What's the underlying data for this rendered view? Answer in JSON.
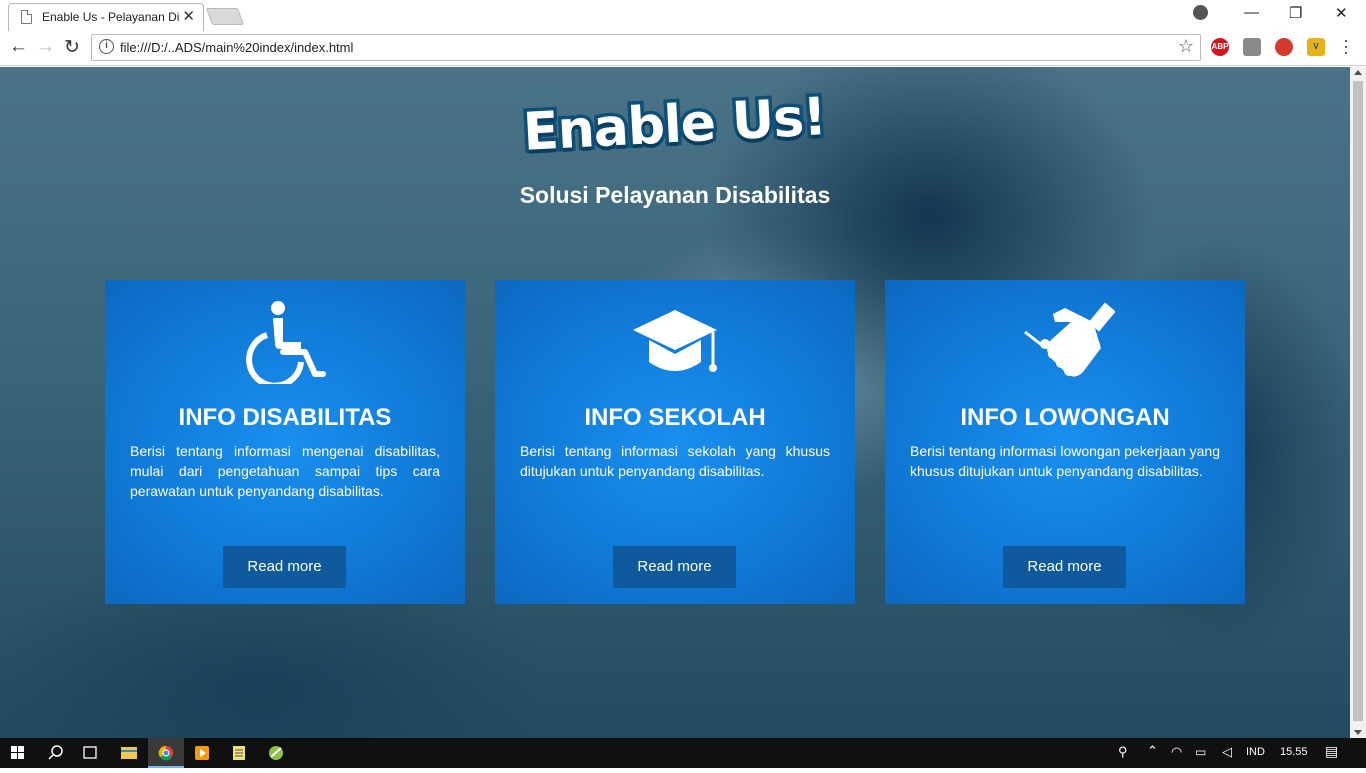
{
  "browser": {
    "tab_title": "Enable Us - Pelayanan Dis",
    "address": "file:///D:/..ADS/main%20index/index.html",
    "window_controls": [
      "—",
      "❐",
      "✕"
    ],
    "extensions": [
      {
        "name": "adblock-plus-icon",
        "label": "ABP",
        "color": "#d5141e"
      },
      {
        "name": "camera-icon",
        "label": "",
        "color": "#8a8a8a"
      },
      {
        "name": "people-icon",
        "label": "",
        "color": "#d33b2c"
      },
      {
        "name": "v-extension-icon",
        "label": "V",
        "color": "#e8b31a"
      }
    ]
  },
  "page": {
    "logo_text": "Enable Us!",
    "subtitle": "Solusi Pelayanan Disabilitas",
    "cards": [
      {
        "icon": "wheelchair-icon",
        "title": "INFO DISABILITAS",
        "description": "Berisi tentang informasi mengenai disabilitas, mulai dari pengetahuan sampai tips cara perawatan untuk penyandang disabilitas.",
        "button": "Read more"
      },
      {
        "icon": "graduation-cap-icon",
        "title": "INFO SEKOLAH",
        "description": "Berisi tentang informasi sekolah yang khusus ditujukan untuk penyandang disabilitas.",
        "button": "Read more"
      },
      {
        "icon": "handshake-icon",
        "title": "INFO LOWONGAN",
        "description": "Berisi tentang informasi lowongan pekerjaan yang khusus ditujukan untuk penyandang disabilitas.",
        "button": "Read more"
      }
    ]
  },
  "taskbar": {
    "language": "IND",
    "time": "15.55"
  }
}
